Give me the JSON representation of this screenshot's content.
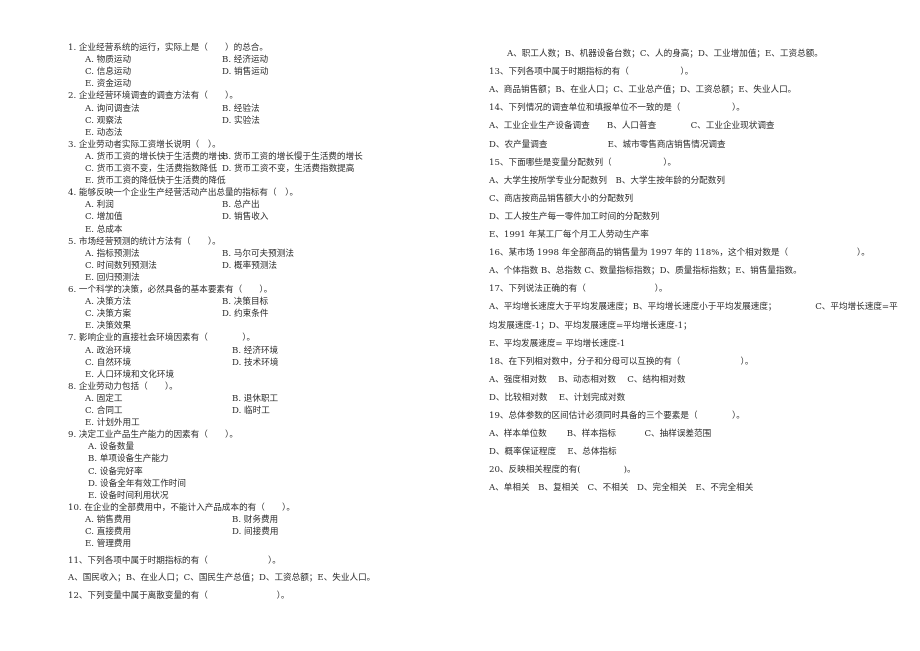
{
  "left": {
    "questions": [
      {
        "stem": "1. 企业经营系统的运行，实际上是（　　）的总合。",
        "options": [
          "A. 物质运动",
          "B. 经济运动",
          "C. 信息运动",
          "D. 销售运动",
          "E. 资金运动"
        ]
      },
      {
        "stem": "2. 企业经营环境调查的调查方法有（　　）。",
        "options": [
          "A. 询问调查法",
          "B. 经验法",
          "C. 观察法",
          "D. 实验法",
          "E. 动态法"
        ]
      },
      {
        "stem": "3. 企业劳动者实际工资增长说明（　）。",
        "options": [
          "A. 货币工资的增长快于生活费的增长",
          "B. 货币工资的增长慢于生活费的增长",
          "C. 货币工资不变，生活费指数降低",
          "D. 货币工资不变，生活费指数提高",
          "E. 货币工资的降低快于生活费的降低"
        ]
      },
      {
        "stem": "4. 能够反映一个企业生产经营活动产出总量的指标有（　）。",
        "options": [
          "A. 利润",
          "B. 总产出",
          "C. 增加值",
          "D. 销售收入",
          "E. 总成本"
        ]
      },
      {
        "stem": "5. 市场经营预测的统计方法有（　　）。",
        "options": [
          "A. 指标预测法",
          "B. 马尔可夫预测法",
          "C. 时间数列预测法",
          "D. 概率预测法",
          "E. 回归预测法"
        ]
      },
      {
        "stem": "6. 一个科学的决策，必然具备的基本要素有（　　）。",
        "options": [
          "A. 决策方法",
          "B. 决策目标",
          "C. 决策方案",
          "D. 约束条件",
          "E. 决策效果"
        ]
      },
      {
        "stem": "7. 影响企业的直接社会环境因素有（　　　　）。",
        "options": [
          "A. 政治环境",
          "B. 经济环境",
          "C. 自然环境",
          "D. 技术环境",
          "E. 人口环境和文化环境"
        ]
      },
      {
        "stem": "8. 企业劳动力包括（　　）。",
        "options": [
          "A. 固定工",
          "B. 退休职工",
          "C. 合同工",
          "D. 临时工",
          "E. 计划外用工"
        ]
      },
      {
        "stem": "9. 决定工业产品生产能力的因素有（　　）。",
        "options": [
          "A. 设备数量",
          "B. 单项设备生产能力",
          "C. 设备完好率",
          "D. 设备全年有效工作时间",
          "E. 设备时间利用状况"
        ]
      },
      {
        "stem": "10. 在企业的全部费用中，不能计入产品成本的有（　　）。",
        "options": [
          "A. 销售费用",
          "B. 财务费用",
          "C. 直接费用",
          "D. 间接费用",
          "E. 管理费用"
        ]
      }
    ],
    "lines": [
      "11、下列各项中属于时期指标的有（　　　　　　　）。",
      "A、国民收入；B、在业人口；C、国民生产总值；D、工资总额；E、失业人口。",
      "12、下列变量中属于离散变量的有（　　　　　　　　）。"
    ]
  },
  "right": {
    "lines": [
      "A、职工人数；B、机器设备台数；C、人的身高；D、工业增加值；E、工资总额。",
      "13、下列各项中属于时期指标的有（　　　　　　）。",
      "A、商品销售额；B、在业人口；C、工业总产值；D、工资总额；E、失业人口。",
      "14、下列情况的调查单位和填报单位不一致的是（　　　　　　）。",
      "A、工业企业生产设备调查　　B、人口普查　　　　C、工业企业现状调查",
      "D、农产量调查　　　　　　　E、城市零售商店销售情况调查",
      "15、下面哪些是变量分配数列（　　　　　　）。",
      "A、大学生按所学专业分配数列　B、大学生按年龄的分配数列",
      "C、商店按商品销售额大小的分配数列",
      "D、工人按生产每一零件加工时间的分配数列",
      "E、1991 年某工厂每个月工人劳动生产率",
      "16、某市场 1998 年全部商品的销售量为 1997 年的 118%，这个相对数是（　　　　　　　　）。",
      "A、个体指数 B、总指数 C、数量指标指数；D、质量指标指数；E、销售量指数。",
      "17、下列说法正确的有（　　　　　　　　）。",
      "A、平均增长速度大于平均发展速度；B、平均增长速度小于平均发展速度；　　　　　C、平均增长速度=平",
      "均发展速度-1；D、平均发展速度=平均增长速度-1；",
      "E、平均发展速度= 平均增长速度-1",
      "18、在下列相对数中，分子和分母可以互换的有（　　　　　　　）。",
      "A、强度相对数　 B、动态相对数　 C、结构相对数",
      "D、比较相对数　 E、计划完成对数",
      "19、总体参数的区间估计必须同时具备的三个要素是（　　　　）。",
      "A、样本单位数　　 B、样本指标　　　 C、抽样误差范围",
      "D、概率保证程度　 E、总体指标",
      "20、反映相关程度的有(　　　　　)。",
      "A、单相关　B、复相关　C、不相关　D、完全相关　E、不完全相关"
    ]
  }
}
